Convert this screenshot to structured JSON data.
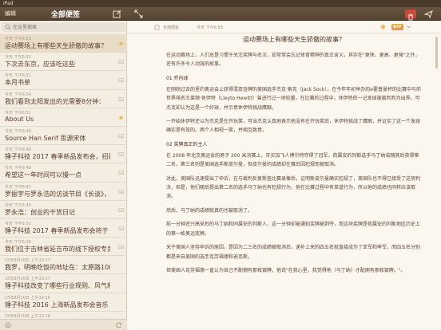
{
  "status_bar": {
    "carrier": "iPad",
    "time": "",
    "battery": ""
  },
  "toolbar": {
    "edit_label": "编辑",
    "title": "全部便签"
  },
  "search": {
    "placeholder": "在这里搜索"
  },
  "notes": [
    {
      "date": "今天 下午6:53",
      "title": "运动赛场上有哪些天生骄傲的故事？",
      "active": true,
      "mark": "star"
    },
    {
      "date": "今天 下午6:52",
      "title": "下次去东京，应该吃这些",
      "mark": "image"
    },
    {
      "date": "今天 下午6:51",
      "title": "本月书单",
      "mark": "image"
    },
    {
      "date": "今天 下午6:54",
      "title": "我们看到太阳发出的光需要8分钟：",
      "mark": "image"
    },
    {
      "date": "今天 下午6:51",
      "title": "About Us",
      "mark": "star"
    },
    {
      "date": "今天 下午6:49",
      "title": "Source Han Serif 思源宋体",
      "mark": "image"
    },
    {
      "date": "今天 下午6:49",
      "title": "锤子科技 2017 春季新品发布会，招募现场...",
      "mark": "image"
    },
    {
      "date": "今天 下午6:48",
      "title": "希望这一年时间可以慢一点",
      "mark": "image"
    },
    {
      "date": "今天 下午6:47",
      "title": "罗振宇与罗永浩的访谈节目《长谈》，6 小...",
      "mark": "image"
    },
    {
      "date": "今天 下午6:40",
      "title": "罗永浩：创业的干货日记",
      "mark": "image"
    },
    {
      "date": "今天 下午6:31",
      "title": "锤子科技 2017 春季新品发布会将于 5 月 9...",
      "mark": "image"
    },
    {
      "date": "今天 下午6:29",
      "title": "我们位于吉林省延吉市的线下授权专卖店，...",
      "mark": "image"
    },
    {
      "date": "15年8月20日 上午10:17",
      "title": "我罗，明晚吃饭的地址在：太原路100号太原...",
      "mark": "none"
    },
    {
      "date": "15年8月20日 上午10:17",
      "title": "锤子科技改变了哪些行业规则、风气和玩法？",
      "mark": "none"
    },
    {
      "date": "15年8月20日 上午10:16",
      "title": "锤子科技 2016 上海新品发布会音乐",
      "mark": "none"
    },
    {
      "date": "15年8月20日 上午10:16",
      "title": "",
      "mark": "none"
    }
  ],
  "note_header": {
    "category": "全部便签",
    "datetime": "今天 下午6:53",
    "badge": "BTF"
  },
  "article": {
    "title": "运动赛场上有哪些天生骄傲的故事？",
    "p1": "在运动赛场上，人们总是习惯于关注奖牌与名次，却常常会忘记体育精神的真正含义，其实在\"更快、更高、更强\"之外，还有许多令人动容的故事。",
    "h1": "01 乔内球",
    "p2": "在刚刚过去的里约奥运会上获得混双金牌的美国选手杰克·索克（Jack Sock），在今年年初举办的e霍普曼杯的比赛中与前世界排名王莱顿·休伊特（Lleyto Hewitt）曾进行过一场较量，在比赛的过程中，休伊特的一记发球被裁判判为出界。可杰克却认为这是一个好球，并示意休伊特挑战鹰眼。",
    "p3": "一开始休伊特还以为杰克是在开玩笑，可当杰克认真地表示他没有在开玩笑后，休伊特挑战了鹰眼，并证实了这一个发球确实是有效的。两个人相视一笑，并相互致意。",
    "h2": "02 奖牌真正的主人",
    "p4": "在 2008 年北京奥运会的男子 200 米决赛上，牙买加飞人博尔特夺得了冠军，荷属安的列斯选手马丁纳诺随其后获得第二名，第三名则是美国选手斯皮尔曼，但皮尔曼的成绩却在赛后因犯规而被取消。",
    "p5": "对此，美国队迅速提出了申诉，在与裁判反复斯查比赛录像后，证明斯皮尔曼确实犯规了，美国队也不得已接受了这项判决，但是，他们随后提出第二名的选手马丁纳也有犯规行为，他在比赛过程中有单道行为，所以他的成绩也同样应该取消。",
    "p6": "然后，马丁纳的成绩就真的也被取消了。",
    "p7": "前一分钟还兴高采烈的马丁纳和同属安的列斯人，这一分钟却被通知奖牌被剥夺，而这块奖牌是荷属安的列斯地区历史上的第一枚奥运奖牌。",
    "p8": "关于美国人坚持申诉的原因，是因为二三名的成绩被取消后，递补上来的四五名就直接成为了亚军和季军，而四五名分别都是来自美国的选手克劳福德和迪克斯。",
    "p9": "但美国人克劳福德一直认为自己不配拥有那枚银牌，他说\"在我心里，我觉得他（马丁纳）才配拥有那枚银牌。\"。"
  }
}
